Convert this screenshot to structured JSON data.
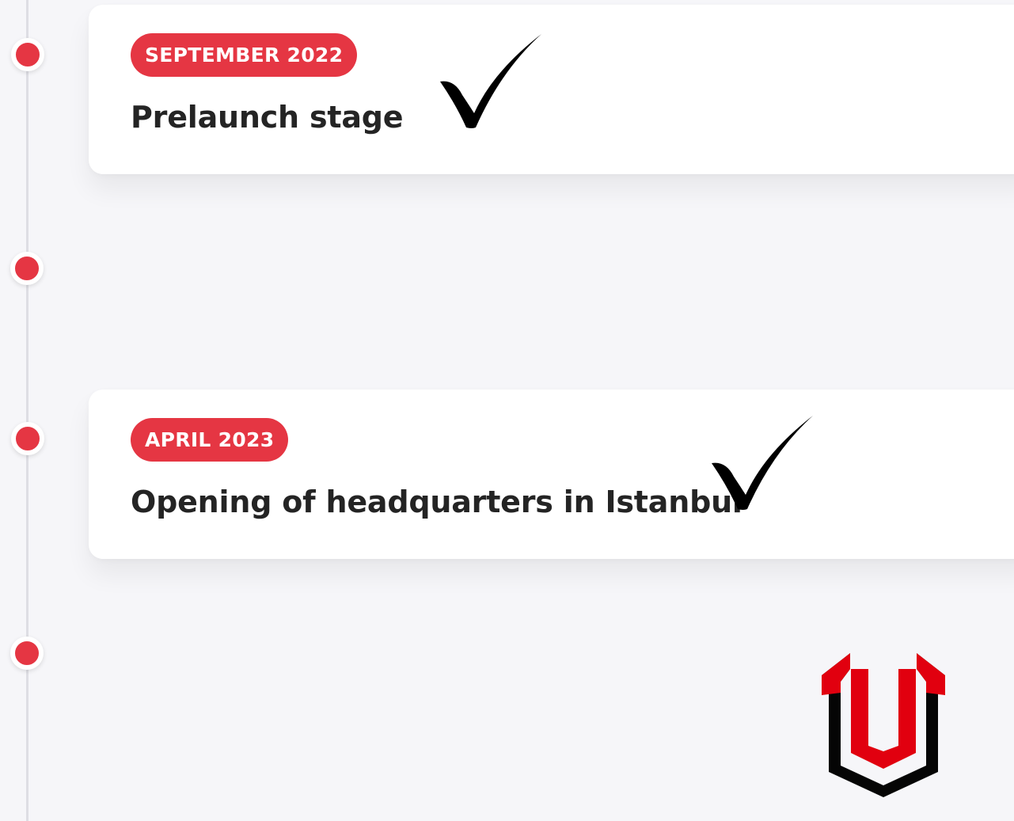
{
  "timeline": {
    "items": [
      {
        "date": "SEPTEMBER 2022",
        "title": "Prelaunch stage"
      },
      {
        "date": "APRIL 2023",
        "title": "Opening of headquarters in Istanbul"
      }
    ]
  },
  "icons": {
    "check": "checkmark-icon",
    "dot": "timeline-dot",
    "logo": "brand-logo"
  },
  "colors": {
    "accent": "#e53643",
    "page_bg": "#f6f6f9",
    "card_bg": "#ffffff",
    "title_text": "#242424",
    "logo_red": "#e1000f",
    "logo_black": "#050505"
  }
}
